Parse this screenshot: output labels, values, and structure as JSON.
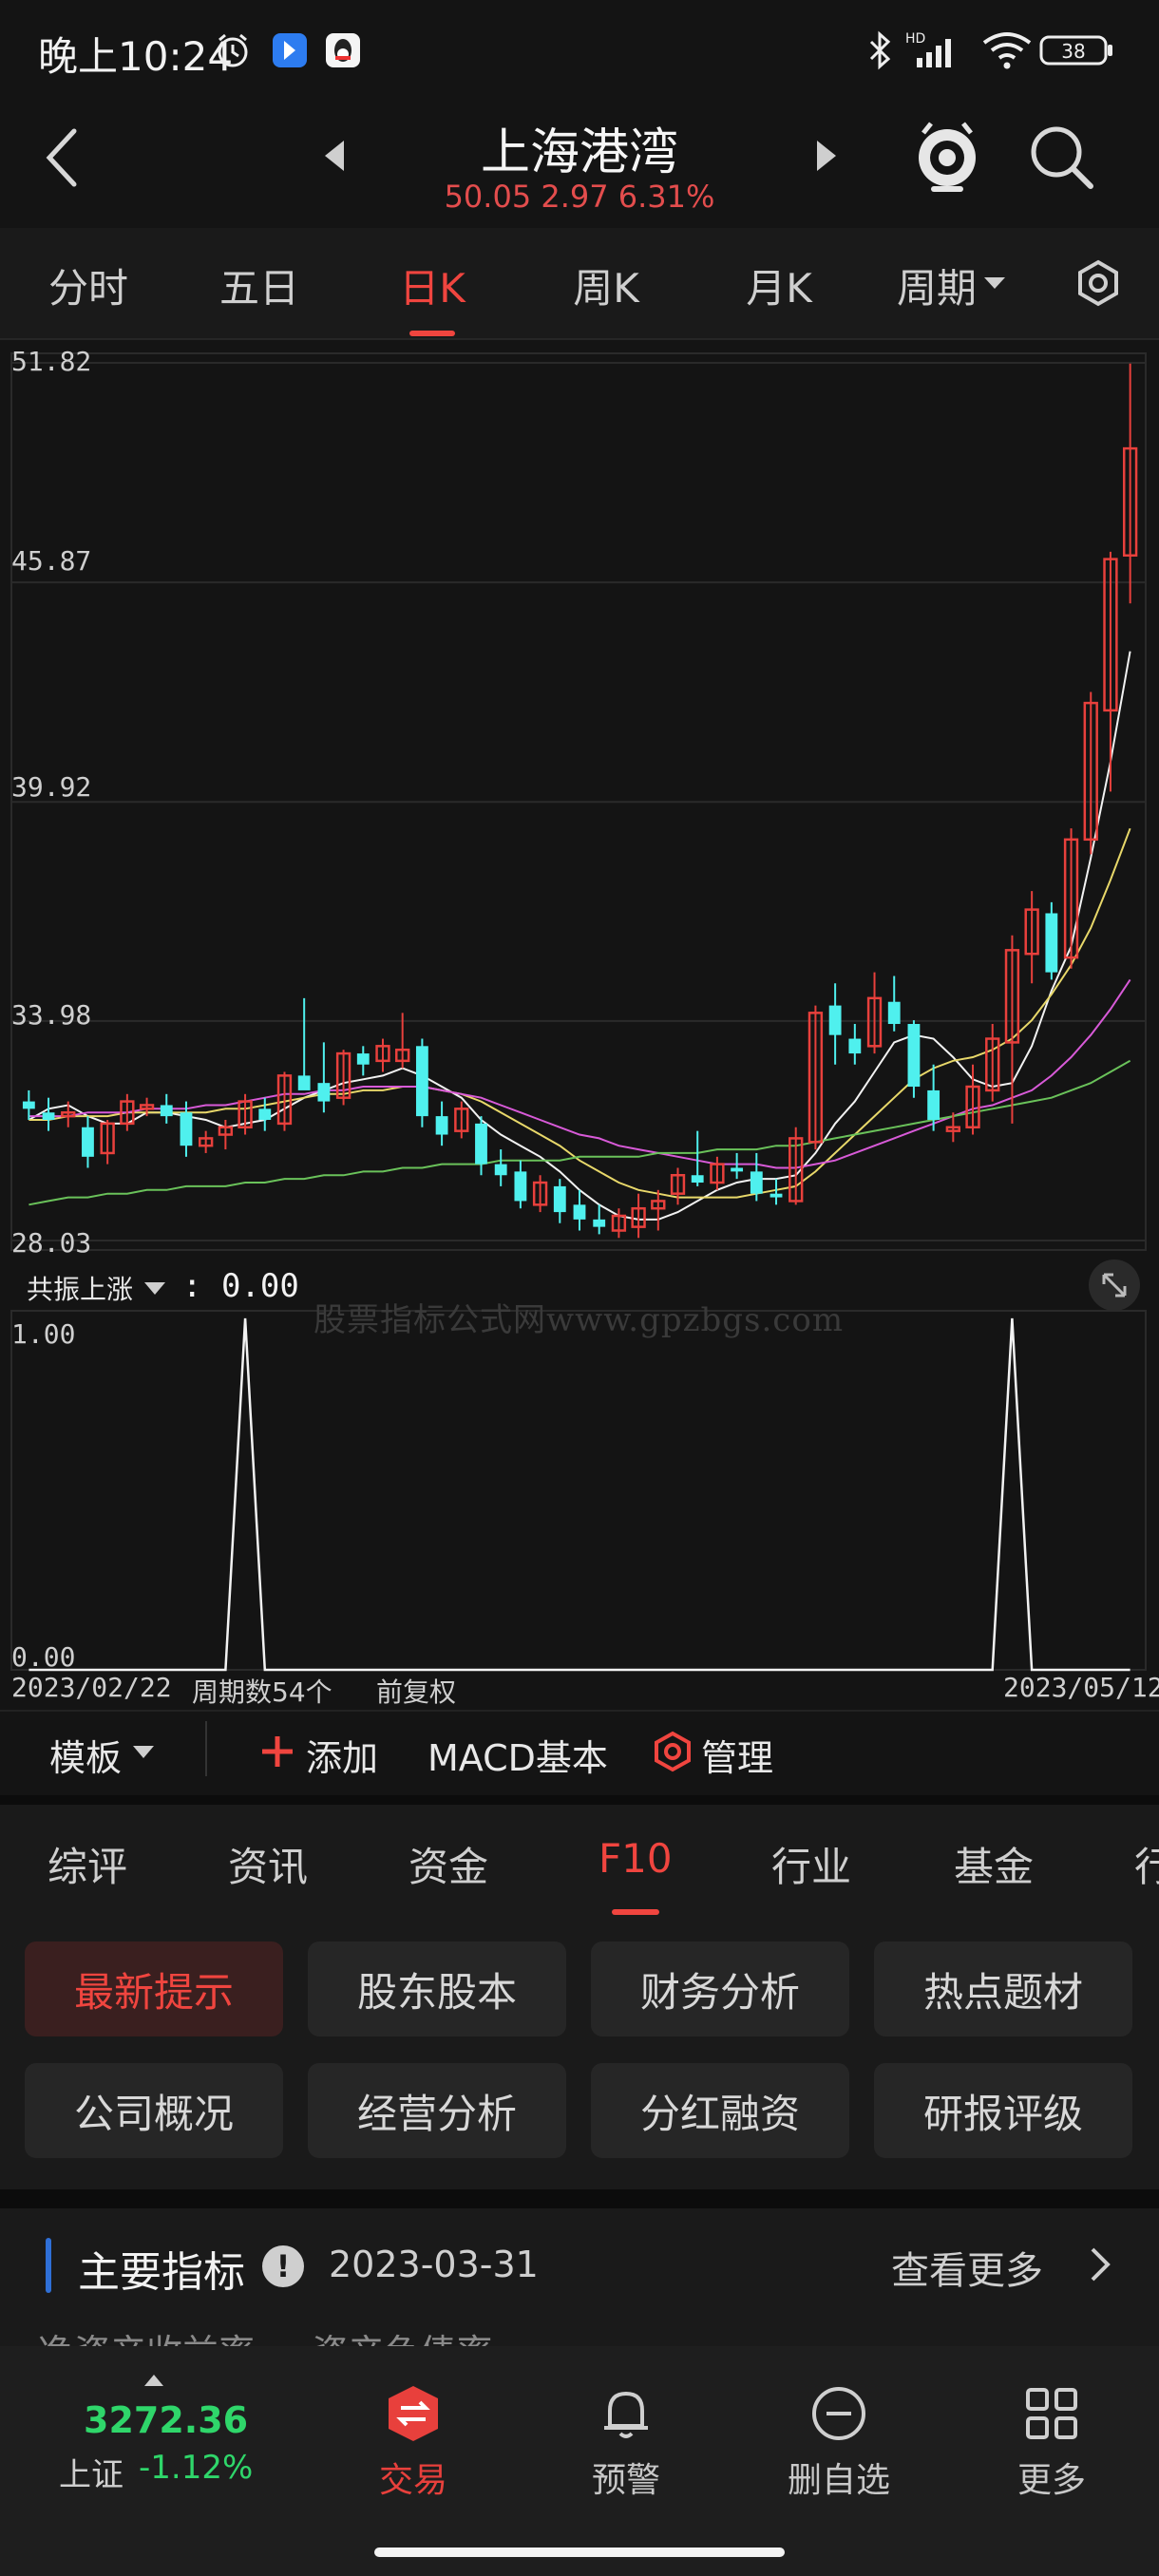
{
  "status_bar": {
    "time": "晚上10:24",
    "battery": "38",
    "network": "HD"
  },
  "header": {
    "title": "上海港湾",
    "price_line": "50.05 2.97 6.31%"
  },
  "period_tabs": [
    {
      "label": "分时"
    },
    {
      "label": "五日"
    },
    {
      "label": "日K"
    },
    {
      "label": "周K"
    },
    {
      "label": "月K"
    },
    {
      "label": "周期"
    }
  ],
  "active_period_tab": "日K",
  "chart": {
    "price_axis": [
      "51.82",
      "45.87",
      "39.92",
      "33.98",
      "28.03"
    ]
  },
  "indicator": {
    "name": "共振上涨",
    "value": ": 0.00",
    "axis_top": "1.00",
    "axis_bottom": "0.00",
    "date_start": "2023/02/22",
    "period_count": "周期数54个",
    "adjust": "前复权",
    "date_end": "2023/05/12"
  },
  "watermark": "股票指标公式网www.gpzbgs.com",
  "toolbar": {
    "template": "模板",
    "add": "添加",
    "macd": "MACD基本",
    "manage": "管理"
  },
  "section_tabs": [
    {
      "label": "综评"
    },
    {
      "label": "资讯"
    },
    {
      "label": "资金"
    },
    {
      "label": "F10"
    },
    {
      "label": "行业"
    },
    {
      "label": "基金"
    },
    {
      "label": "行"
    }
  ],
  "f10_buttons": [
    [
      "最新提示",
      "股东股本",
      "财务分析",
      "热点题材"
    ],
    [
      "公司概况",
      "经营分析",
      "分红融资",
      "研报评级"
    ]
  ],
  "indicators_section": {
    "title": "主要指标",
    "date": "2023-03-31",
    "more": "查看更多",
    "partial_row": "净资产收益率 ... 资产负债率"
  },
  "bottom_nav": {
    "index_value": "3272.36",
    "index_name": "上证",
    "index_change": "-1.12%",
    "items": [
      {
        "label": "交易"
      },
      {
        "label": "预警"
      },
      {
        "label": "删自选"
      },
      {
        "label": "更多"
      }
    ]
  },
  "colors": {
    "up": "#e8403c",
    "down": "#4ff0ee",
    "accent": "#f0453f",
    "index_green": "#2fd66a"
  },
  "chart_data": {
    "type": "candlestick",
    "ylim": [
      28.03,
      51.82
    ],
    "y_ticks": [
      51.82,
      45.87,
      39.92,
      33.98,
      28.03
    ],
    "x_range": [
      "2023/02/22",
      "2023/05/12"
    ],
    "candles": [
      [
        31.8,
        32.1,
        31.3,
        31.6
      ],
      [
        31.5,
        31.9,
        31.0,
        31.3
      ],
      [
        31.4,
        31.8,
        31.1,
        31.5
      ],
      [
        31.1,
        31.4,
        30.0,
        30.3
      ],
      [
        30.4,
        31.3,
        30.1,
        31.2
      ],
      [
        31.2,
        32.0,
        31.0,
        31.8
      ],
      [
        31.6,
        31.9,
        31.4,
        31.7
      ],
      [
        31.7,
        32.0,
        31.2,
        31.4
      ],
      [
        31.5,
        31.8,
        30.3,
        30.6
      ],
      [
        30.6,
        31.0,
        30.4,
        30.8
      ],
      [
        30.9,
        31.3,
        30.5,
        31.1
      ],
      [
        31.1,
        32.0,
        30.9,
        31.8
      ],
      [
        31.6,
        31.9,
        31.0,
        31.3
      ],
      [
        31.2,
        32.6,
        31.0,
        32.5
      ],
      [
        32.5,
        34.6,
        32.3,
        32.1
      ],
      [
        32.3,
        33.4,
        31.5,
        31.8
      ],
      [
        31.9,
        33.2,
        31.7,
        33.1
      ],
      [
        33.1,
        33.3,
        32.5,
        32.8
      ],
      [
        32.9,
        33.5,
        32.6,
        33.3
      ],
      [
        32.9,
        34.2,
        32.7,
        33.2
      ],
      [
        33.3,
        33.5,
        31.1,
        31.4
      ],
      [
        31.4,
        31.8,
        30.6,
        30.9
      ],
      [
        31.0,
        31.8,
        30.8,
        31.6
      ],
      [
        31.2,
        31.4,
        29.8,
        30.1
      ],
      [
        30.1,
        30.5,
        29.5,
        29.8
      ],
      [
        29.9,
        30.2,
        28.9,
        29.1
      ],
      [
        29.0,
        29.8,
        28.8,
        29.6
      ],
      [
        29.5,
        29.7,
        28.5,
        28.8
      ],
      [
        29.0,
        29.4,
        28.3,
        28.6
      ],
      [
        28.6,
        29.0,
        28.2,
        28.4
      ],
      [
        28.3,
        28.9,
        28.1,
        28.7
      ],
      [
        28.4,
        29.3,
        28.1,
        28.9
      ],
      [
        28.9,
        29.4,
        28.3,
        29.1
      ],
      [
        29.3,
        30.0,
        29.0,
        29.8
      ],
      [
        29.8,
        31.0,
        29.5,
        29.6
      ],
      [
        29.6,
        30.3,
        29.4,
        30.1
      ],
      [
        30.0,
        30.4,
        29.7,
        29.9
      ],
      [
        29.9,
        30.4,
        29.1,
        29.3
      ],
      [
        29.3,
        29.7,
        29.0,
        29.2
      ],
      [
        29.1,
        31.1,
        29.0,
        30.8
      ],
      [
        30.7,
        34.4,
        30.5,
        34.2
      ],
      [
        34.4,
        35.0,
        32.8,
        33.6
      ],
      [
        33.5,
        33.9,
        32.8,
        33.1
      ],
      [
        33.3,
        35.3,
        33.1,
        34.6
      ],
      [
        34.5,
        35.2,
        33.7,
        33.9
      ],
      [
        33.9,
        34.0,
        31.9,
        32.2
      ],
      [
        32.1,
        32.8,
        31.0,
        31.3
      ],
      [
        31.0,
        31.5,
        30.7,
        31.1
      ],
      [
        31.1,
        32.8,
        30.9,
        32.2
      ],
      [
        32.1,
        33.9,
        31.8,
        33.5
      ],
      [
        33.4,
        36.3,
        31.2,
        35.9
      ],
      [
        35.8,
        37.5,
        35.0,
        37.0
      ],
      [
        36.9,
        37.2,
        35.1,
        35.3
      ],
      [
        35.7,
        39.2,
        35.4,
        38.9
      ],
      [
        38.9,
        42.9,
        38.5,
        42.6
      ],
      [
        42.4,
        46.7,
        40.2,
        46.5
      ],
      [
        46.6,
        51.8,
        45.3,
        49.5
      ]
    ],
    "candle_fields": [
      "open",
      "high",
      "low",
      "close"
    ],
    "series": [
      {
        "color": "#f2f2f2",
        "values": [
          31.3,
          31.6,
          31.7,
          31.4,
          31.2,
          31.2,
          31.5,
          31.5,
          31.4,
          31.3,
          31.1,
          31.2,
          31.3,
          31.6,
          31.9,
          32.1,
          32.3,
          32.4,
          32.5,
          32.7,
          32.5,
          32.2,
          31.9,
          31.3,
          30.9,
          30.6,
          30.3,
          29.9,
          29.4,
          29.0,
          28.7,
          28.6,
          28.6,
          28.8,
          29.1,
          29.4,
          29.6,
          29.7,
          29.7,
          29.8,
          30.4,
          31.2,
          31.8,
          32.6,
          33.4,
          33.6,
          33.5,
          33.0,
          32.4,
          32.2,
          32.3,
          33.3,
          34.8,
          36.0,
          38.4,
          41.0,
          44.0
        ]
      },
      {
        "color": "#e8d86a",
        "values": [
          31.3,
          31.3,
          31.4,
          31.4,
          31.4,
          31.5,
          31.5,
          31.5,
          31.5,
          31.5,
          31.6,
          31.6,
          31.7,
          31.8,
          31.9,
          32.0,
          32.0,
          32.1,
          32.1,
          32.2,
          32.2,
          32.1,
          32.0,
          31.8,
          31.5,
          31.2,
          30.9,
          30.6,
          30.2,
          29.9,
          29.6,
          29.4,
          29.3,
          29.2,
          29.2,
          29.2,
          29.2,
          29.3,
          29.4,
          29.5,
          29.9,
          30.4,
          30.9,
          31.4,
          31.9,
          32.4,
          32.7,
          32.9,
          33.0,
          33.2,
          33.5,
          34.0,
          34.7,
          35.5,
          36.5,
          37.8,
          39.2
        ]
      },
      {
        "color": "#d85ad8",
        "values": [
          31.4,
          31.4,
          31.4,
          31.5,
          31.5,
          31.5,
          31.6,
          31.6,
          31.6,
          31.7,
          31.7,
          31.8,
          31.9,
          32.0,
          32.0,
          32.1,
          32.1,
          32.2,
          32.2,
          32.2,
          32.2,
          32.1,
          32.0,
          31.9,
          31.7,
          31.5,
          31.3,
          31.1,
          30.9,
          30.8,
          30.6,
          30.5,
          30.4,
          30.3,
          30.2,
          30.1,
          30.1,
          30.1,
          30.0,
          30.0,
          30.1,
          30.2,
          30.4,
          30.6,
          30.8,
          31.0,
          31.2,
          31.4,
          31.6,
          31.7,
          31.9,
          32.1,
          32.5,
          33.0,
          33.6,
          34.3,
          35.1
        ]
      },
      {
        "color": "#6ac25a",
        "values": [
          29.0,
          29.1,
          29.2,
          29.2,
          29.3,
          29.3,
          29.4,
          29.4,
          29.5,
          29.5,
          29.5,
          29.6,
          29.6,
          29.7,
          29.7,
          29.8,
          29.8,
          29.9,
          29.9,
          30.0,
          30.0,
          30.1,
          30.1,
          30.1,
          30.2,
          30.2,
          30.2,
          30.2,
          30.3,
          30.3,
          30.3,
          30.3,
          30.4,
          30.4,
          30.4,
          30.5,
          30.5,
          30.5,
          30.6,
          30.6,
          30.7,
          30.8,
          30.9,
          31.0,
          31.1,
          31.2,
          31.3,
          31.4,
          31.5,
          31.6,
          31.7,
          31.8,
          31.9,
          32.1,
          32.3,
          32.6,
          32.9
        ]
      }
    ],
    "indicator_series": {
      "name": "共振上涨",
      "ylim": [
        0,
        1
      ],
      "values": [
        0,
        0,
        0,
        0,
        0,
        0,
        0,
        0,
        0,
        0,
        0,
        1,
        0,
        0,
        0,
        0,
        0,
        0,
        0,
        0,
        0,
        0,
        0,
        0,
        0,
        0,
        0,
        0,
        0,
        0,
        0,
        0,
        0,
        0,
        0,
        0,
        0,
        0,
        0,
        0,
        0,
        0,
        0,
        0,
        0,
        0,
        0,
        0,
        0,
        0,
        1,
        0,
        0,
        0,
        0,
        0,
        0
      ]
    }
  }
}
